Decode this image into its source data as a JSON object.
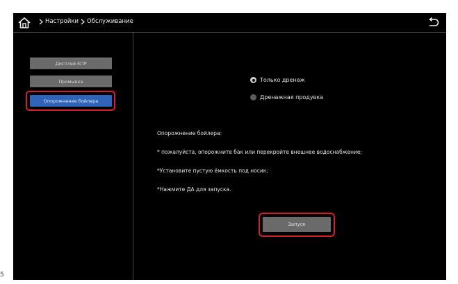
{
  "header": {
    "breadcrumb": [
      "Настройки",
      "Обслуживание"
    ]
  },
  "sidebar": {
    "items": [
      {
        "label": "Дисплей КПР"
      },
      {
        "label": "Промывка"
      },
      {
        "label": "Опорожнение бойлера"
      }
    ],
    "active_index": 2
  },
  "options": {
    "radio_items": [
      {
        "label": "Только дренаж",
        "selected": true
      },
      {
        "label": "Дренажная продувка",
        "selected": false
      }
    ]
  },
  "instructions": {
    "title": "Опорожнение бойлера:",
    "lines": [
      "* пожалуйста, опорожните бак или перекройте внешнее водоснабжение;",
      "*Установите пустую ёмкость под носик;",
      "*Нажмите ДА для запуска."
    ]
  },
  "actions": {
    "start_label": "Запуск"
  },
  "colors": {
    "screen_bg": "#000000",
    "button_gray": "#6a6a6a",
    "active_blue": "#2f64b8",
    "highlight_red": "#d41f2e"
  },
  "icons": {
    "home": "home-icon",
    "back": "back-arrow-icon",
    "separator": "chevron-right-icon"
  },
  "corner_text": "5"
}
